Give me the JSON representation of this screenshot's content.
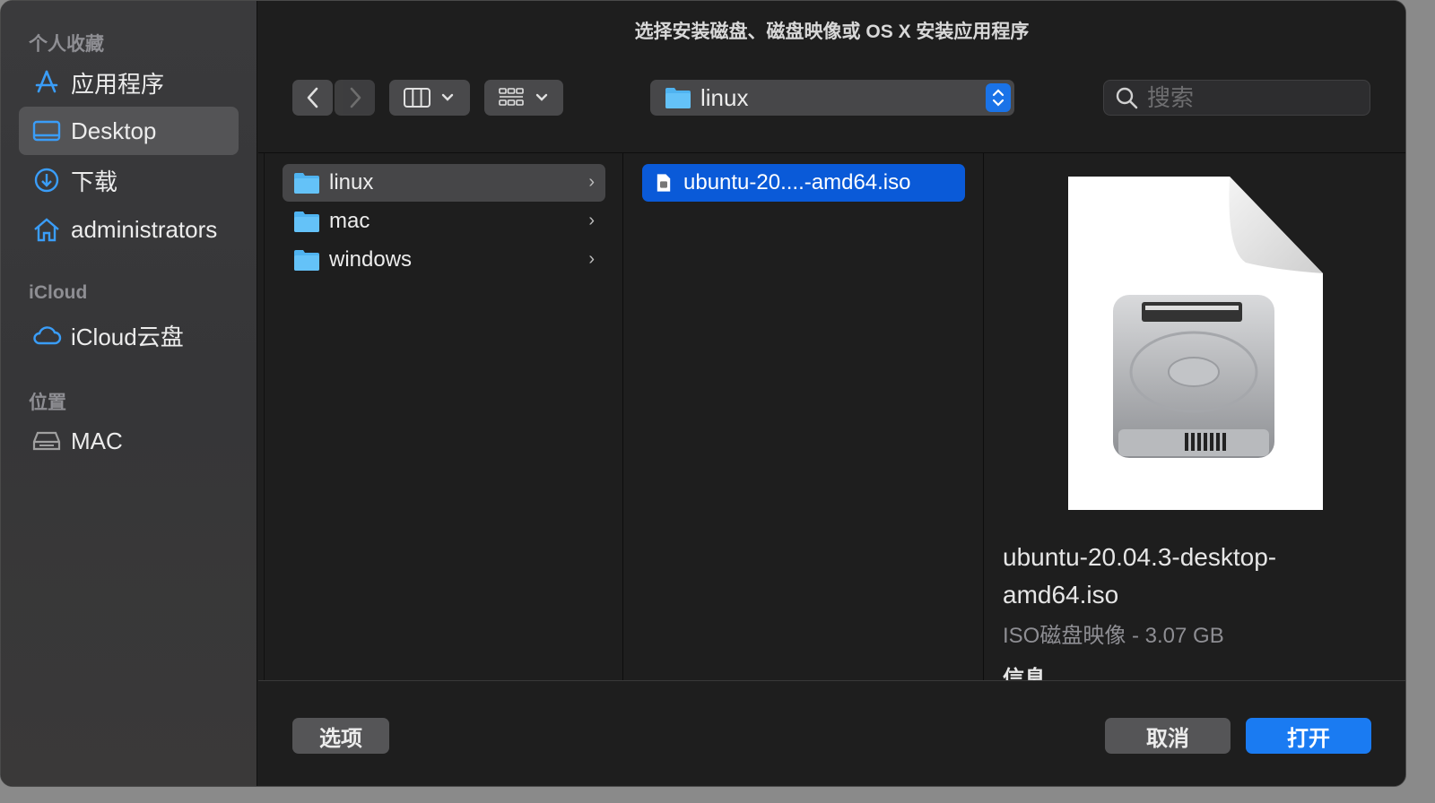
{
  "window": {
    "title": "选择安装磁盘、磁盘映像或 OS X 安装应用程序"
  },
  "sidebar": {
    "sections": [
      {
        "label": "个人收藏"
      },
      {
        "label": "iCloud"
      },
      {
        "label": "位置"
      }
    ],
    "items": [
      {
        "label": "应用程序",
        "icon": "applications-icon",
        "selected": false
      },
      {
        "label": "Desktop",
        "icon": "desktop-icon",
        "selected": true
      },
      {
        "label": "下载",
        "icon": "downloads-icon",
        "selected": false
      },
      {
        "label": "administrators",
        "icon": "home-icon",
        "selected": false
      },
      {
        "label": "iCloud云盘",
        "icon": "icloud-icon",
        "selected": false
      },
      {
        "label": "MAC",
        "icon": "disk-icon",
        "selected": false
      }
    ]
  },
  "toolbar": {
    "path_label": "linux",
    "search_placeholder": "搜索"
  },
  "columns": {
    "col1": [
      {
        "label": "linux",
        "selected": true
      },
      {
        "label": "mac",
        "selected": false
      },
      {
        "label": "windows",
        "selected": false
      }
    ],
    "col2": [
      {
        "label": "ubuntu-20....-amd64.iso",
        "selected": true
      }
    ]
  },
  "preview": {
    "filename": "ubuntu-20.04.3-desktop-amd64.iso",
    "filename_line1": "ubuntu-20.04.3-desktop-",
    "filename_line2": "amd64.iso",
    "meta": "ISO磁盘映像 - 3.07 GB",
    "info_heading": "信息"
  },
  "buttons": {
    "options": "选项",
    "cancel": "取消",
    "open": "打开"
  },
  "colors": {
    "accent": "#1a7bf2",
    "selection_blue": "#0a5ad8",
    "folder_blue": "#4fb3f0"
  }
}
